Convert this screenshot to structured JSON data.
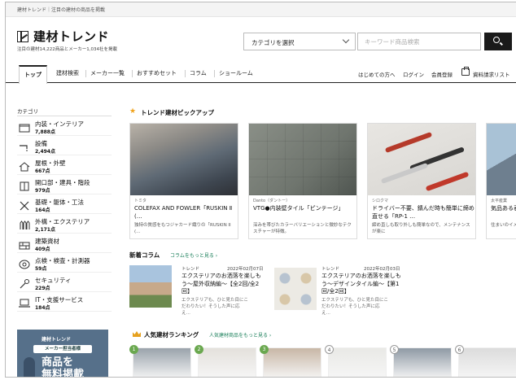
{
  "top_strip": {
    "text": "建材トレンド｜注目の建材の商品を掲載"
  },
  "header": {
    "logo_text": "建材トレンド",
    "logo_sub": "注目の建材14,222商品とメーカー1,034社を掲載",
    "category_select": "カテゴリを選択",
    "search_placeholder": "キーワード商品検索"
  },
  "nav": {
    "items": [
      "トップ",
      "建材検索",
      "メーカー一覧",
      "おすすめセット",
      "コラム",
      "ショールーム"
    ],
    "util": [
      "はじめての方へ",
      "ログイン",
      "会員登録",
      "資料請求リスト"
    ]
  },
  "sidebar": {
    "heading": "カテゴリ",
    "items": [
      {
        "label": "内装・インテリア",
        "count": "7,888点",
        "icon": "interior-icon"
      },
      {
        "label": "設備",
        "count": "2,494点",
        "icon": "faucet-icon"
      },
      {
        "label": "屋根・外壁",
        "count": "667点",
        "icon": "roof-icon"
      },
      {
        "label": "開口部・建具・階段",
        "count": "979点",
        "icon": "door-icon"
      },
      {
        "label": "基礎・躯体・工法",
        "count": "164点",
        "icon": "structure-icon"
      },
      {
        "label": "外構・エクステリア",
        "count": "2,171点",
        "icon": "fence-icon"
      },
      {
        "label": "建築資材",
        "count": "409点",
        "icon": "brick-icon"
      },
      {
        "label": "点検・検査・計測器",
        "count": "59点",
        "icon": "meter-icon"
      },
      {
        "label": "セキュリティ",
        "count": "229点",
        "icon": "key-icon"
      },
      {
        "label": "IT・支援サービス",
        "count": "184点",
        "icon": "laptop-icon"
      }
    ]
  },
  "banner": {
    "brand": "建材トレンド",
    "badge": "メーカー担当者様",
    "headline_1": "商品を",
    "headline_2": "無料掲載"
  },
  "pickup": {
    "title": "トレンド建材ピックアップ",
    "cards": [
      {
        "maker": "トミタ",
        "title": "COLEFAX AND FOWLER「RUSKIN Ⅱ (…",
        "desc": "独特の質感をもつジャカード織りの「RUSKIN II (…"
      },
      {
        "maker": "Danto（ダントー）",
        "title": "VTG●内装壁タイル「ピンテージ」",
        "desc": "深みを帯びたカラーバリエーションと微妙なテクスチャーが特徴。"
      },
      {
        "maker": "シロクマ",
        "title": "ドライバー不要、錆んだ時も簡単に締め直せる「RP-1 …",
        "desc": "締め直しも取り外しも簡単なので、メンテナンスが楽に"
      },
      {
        "maker": "太平産業",
        "title": "気品ある表情が美しく…",
        "desc": "住まいのイメ… る 意匠なバリ…"
      }
    ]
  },
  "columns": {
    "title": "新着コラム",
    "more": "コラムをもっと見る ›",
    "items": [
      {
        "tag": "トレンド",
        "date": "2022年02月07日",
        "title": "エクステリアのお洒落を楽しもう〜屋外収納編〜【全2回/全2回】",
        "desc": "エクステリアも、ひと見た目にこだわりたい！そうした声に応え…"
      },
      {
        "tag": "トレンド",
        "date": "2022年02月03日",
        "title": "エクステリアのお洒落を楽しもう〜デザインタイル編〜【第1回/全2回】",
        "desc": "エクステリアも、ひと見た目にこだわりたい！そうした声に応え…"
      }
    ]
  },
  "ranking": {
    "title": "人気建材ランキング",
    "more": "人気建材商品をもっと見る ›",
    "ranks": [
      "1",
      "2",
      "3",
      "4",
      "5",
      "6"
    ]
  }
}
